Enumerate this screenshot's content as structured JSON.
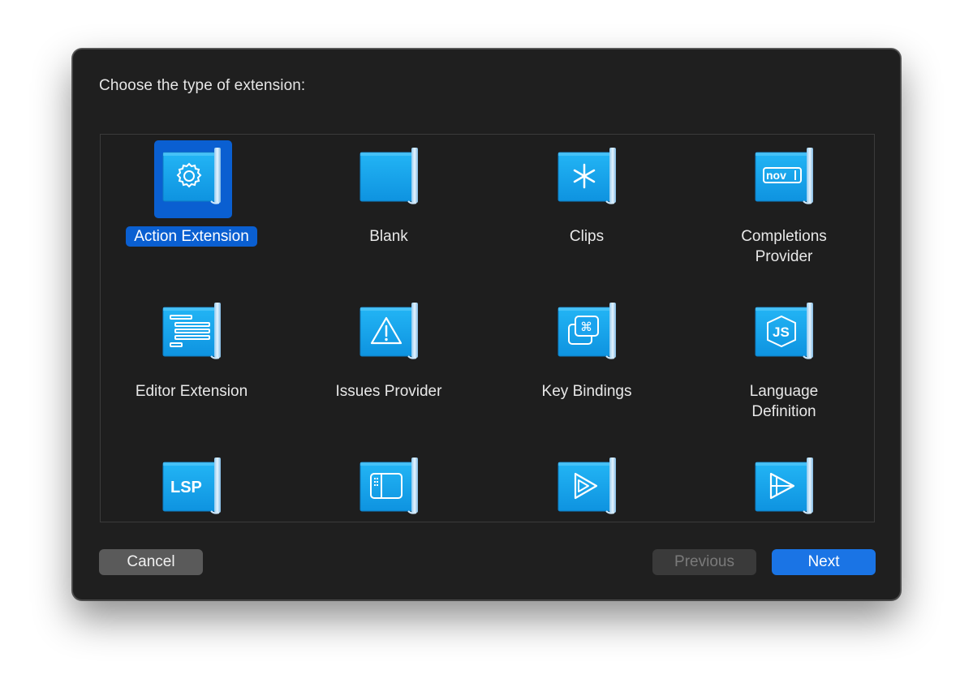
{
  "dialog": {
    "prompt": "Choose the type of extension:"
  },
  "templates": [
    {
      "label": "Action Extension",
      "icon": "gear-icon",
      "selected": true
    },
    {
      "label": "Blank",
      "icon": "blank-icon",
      "selected": false
    },
    {
      "label": "Clips",
      "icon": "asterisk-icon",
      "selected": false
    },
    {
      "label": "Completions Provider",
      "icon": "nov-icon",
      "selected": false
    },
    {
      "label": "Editor Extension",
      "icon": "text-lines-icon",
      "selected": false
    },
    {
      "label": "Issues Provider",
      "icon": "warning-icon",
      "selected": false
    },
    {
      "label": "Key Bindings",
      "icon": "command-key-icon",
      "selected": false
    },
    {
      "label": "Language Definition",
      "icon": "js-icon",
      "selected": false
    },
    {
      "label": "",
      "icon": "lsp-icon",
      "icon_text": "LSP",
      "selected": false
    },
    {
      "label": "",
      "icon": "sidebar-icon",
      "selected": false
    },
    {
      "label": "",
      "icon": "play-icon",
      "selected": false
    },
    {
      "label": "",
      "icon": "play-split-icon",
      "selected": false
    }
  ],
  "buttons": {
    "cancel": "Cancel",
    "previous": "Previous",
    "next": "Next"
  },
  "colors": {
    "selection": "#0a5fd1",
    "primary_button": "#1a74e5",
    "icon_blue": "#1aa3ee"
  }
}
